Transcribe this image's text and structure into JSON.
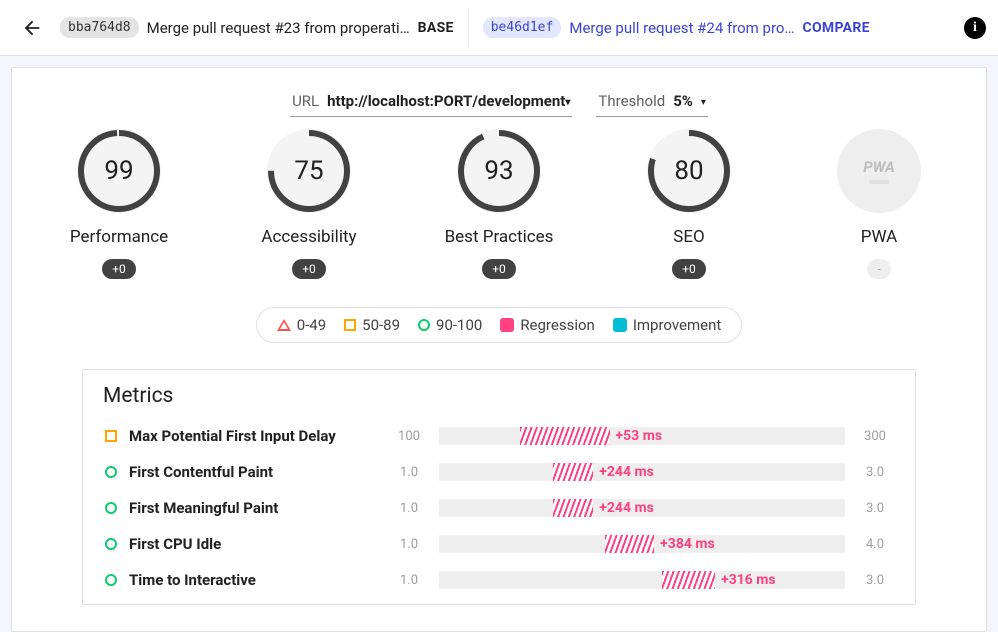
{
  "topbar": {
    "base": {
      "hash": "bba764d8",
      "message": "Merge pull request #23 from properati…",
      "tag": "BASE"
    },
    "compare": {
      "hash": "be46d1ef",
      "message": "Merge pull request #24 from pro…",
      "tag": "COMPARE"
    }
  },
  "selectors": {
    "url_label": "URL",
    "url_value": "http://localhost:PORT/development",
    "threshold_label": "Threshold",
    "threshold_value": "5%"
  },
  "gauges": [
    {
      "label": "Performance",
      "score": "99",
      "pct": 99,
      "delta": "+0"
    },
    {
      "label": "Accessibility",
      "score": "75",
      "pct": 75,
      "delta": "+0"
    },
    {
      "label": "Best Practices",
      "score": "93",
      "pct": 93,
      "delta": "+0"
    },
    {
      "label": "SEO",
      "score": "80",
      "pct": 80,
      "delta": "+0"
    }
  ],
  "pwa": {
    "label": "PWA",
    "acronym": "PWA",
    "delta": "-"
  },
  "legend": {
    "r0": "0-49",
    "r1": "50-89",
    "r2": "90-100",
    "regression": "Regression",
    "improvement": "Improvement"
  },
  "metrics": {
    "title": "Metrics",
    "rows": [
      {
        "status": "warn",
        "name": "Max Potential First Input Delay",
        "min": "100",
        "max": "300",
        "delta": "+53 ms",
        "start": 20,
        "width": 22
      },
      {
        "status": "pass",
        "name": "First Contentful Paint",
        "min": "1.0",
        "max": "3.0",
        "delta": "+244 ms",
        "start": 28,
        "width": 10
      },
      {
        "status": "pass",
        "name": "First Meaningful Paint",
        "min": "1.0",
        "max": "3.0",
        "delta": "+244 ms",
        "start": 28,
        "width": 10
      },
      {
        "status": "pass",
        "name": "First CPU Idle",
        "min": "1.0",
        "max": "4.0",
        "delta": "+384 ms",
        "start": 41,
        "width": 12
      },
      {
        "status": "pass",
        "name": "Time to Interactive",
        "min": "1.0",
        "max": "3.0",
        "delta": "+316 ms",
        "start": 55,
        "width": 13
      }
    ]
  }
}
